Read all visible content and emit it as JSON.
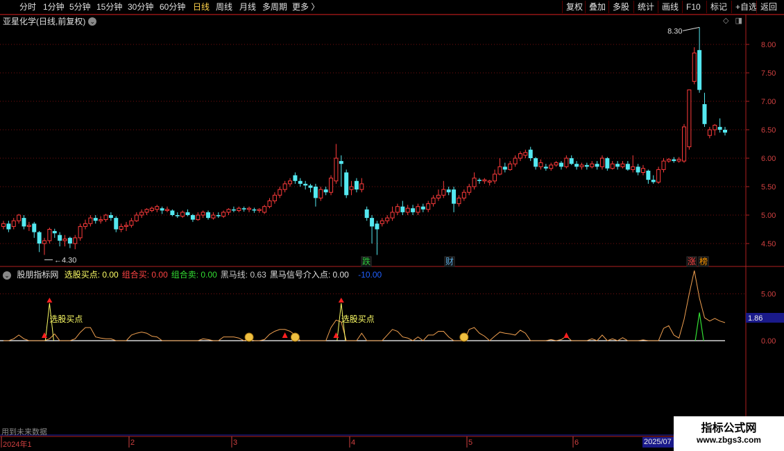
{
  "toolbar": {
    "periods": [
      "分时",
      "1分钟",
      "5分钟",
      "15分钟",
      "30分钟",
      "60分钟",
      "日线",
      "周线",
      "月线",
      "多周期",
      "更多"
    ],
    "selected_period": "日线",
    "more_arrow": "〉",
    "right_buttons": [
      "复权",
      "叠加",
      "多股",
      "统计",
      "画线",
      "F10",
      "标记",
      "+自选",
      "返回"
    ]
  },
  "main_chart": {
    "title": "亚星化学(日线,前复权)",
    "y_ticks": [
      "8.00",
      "7.50",
      "7.00",
      "6.50",
      "6.00",
      "5.50",
      "5.00",
      "4.50"
    ],
    "high_label": "8.30",
    "low_label": "4.30",
    "tags": [
      {
        "text": "跌",
        "color": "#2ecc40"
      },
      {
        "text": "财",
        "color": "#5dade2"
      },
      {
        "text": "涨",
        "color": "#ff4444"
      },
      {
        "text": "榜",
        "color": "#ff9900"
      }
    ],
    "colors": {
      "up": "#ff3b3b",
      "down": "#54e8f0",
      "grid": "#7a1010",
      "axis": "#b02020"
    }
  },
  "indicator": {
    "name": "股朋指标网",
    "fields": [
      {
        "label": "选股买点:",
        "value": "0.00",
        "color": "#ffff66"
      },
      {
        "label": "组合买:",
        "value": "0.00",
        "color": "#ff4444"
      },
      {
        "label": "组合卖:",
        "value": "0.00",
        "color": "#33dd33"
      },
      {
        "label": "黑马线:",
        "value": "0.63",
        "color": "#c8c8c8"
      },
      {
        "label": "黑马信号介入点:",
        "value": "0.00",
        "color": "#e0e0e0"
      }
    ],
    "extra_value": "-10.00",
    "y_ticks": [
      "5.00",
      "0.00"
    ],
    "cursor_value": "1.86",
    "signal_text": "选股买点"
  },
  "future_note": "用到未来数据",
  "date_axis": {
    "labels": [
      "2024年1",
      "2",
      "3",
      "4",
      "5",
      "6"
    ],
    "current": "2025/07"
  },
  "watermark": {
    "line1": "指标公式网",
    "line2": "www.zbgs3.com"
  },
  "chart_data": {
    "type": "candlestick",
    "title": "亚星化学(日线,前复权)",
    "ylim": [
      4.2,
      8.4
    ],
    "candles": [
      {
        "o": 4.8,
        "c": 4.85,
        "h": 4.9,
        "l": 4.75
      },
      {
        "o": 4.85,
        "c": 4.75,
        "h": 4.9,
        "l": 4.7
      },
      {
        "o": 4.8,
        "c": 4.9,
        "h": 4.95,
        "l": 4.75
      },
      {
        "o": 4.9,
        "c": 5.0,
        "h": 5.02,
        "l": 4.85
      },
      {
        "o": 4.95,
        "c": 4.8,
        "h": 5.0,
        "l": 4.75
      },
      {
        "o": 4.8,
        "c": 4.82,
        "h": 4.88,
        "l": 4.72
      },
      {
        "o": 4.85,
        "c": 4.7,
        "h": 4.88,
        "l": 4.6
      },
      {
        "o": 4.7,
        "c": 4.5,
        "h": 4.72,
        "l": 4.35
      },
      {
        "o": 4.5,
        "c": 4.55,
        "h": 4.6,
        "l": 4.3
      },
      {
        "o": 4.55,
        "c": 4.75,
        "h": 4.78,
        "l": 4.5
      },
      {
        "o": 4.72,
        "c": 4.68,
        "h": 4.76,
        "l": 4.6
      },
      {
        "o": 4.65,
        "c": 4.55,
        "h": 4.7,
        "l": 4.45
      },
      {
        "o": 4.55,
        "c": 4.58,
        "h": 4.65,
        "l": 4.45
      },
      {
        "o": 4.6,
        "c": 4.5,
        "h": 4.62,
        "l": 4.42
      },
      {
        "o": 4.5,
        "c": 4.6,
        "h": 4.65,
        "l": 4.4
      },
      {
        "o": 4.6,
        "c": 4.8,
        "h": 4.85,
        "l": 4.55
      },
      {
        "o": 4.8,
        "c": 4.85,
        "h": 4.92,
        "l": 4.75
      },
      {
        "o": 4.85,
        "c": 4.95,
        "h": 5.0,
        "l": 4.8
      },
      {
        "o": 4.95,
        "c": 4.9,
        "h": 5.0,
        "l": 4.85
      },
      {
        "o": 4.9,
        "c": 4.92,
        "h": 4.98,
        "l": 4.85
      },
      {
        "o": 4.92,
        "c": 5.0,
        "h": 5.02,
        "l": 4.88
      },
      {
        "o": 5.0,
        "c": 4.95,
        "h": 5.05,
        "l": 4.9
      },
      {
        "o": 4.95,
        "c": 4.75,
        "h": 4.98,
        "l": 4.7
      },
      {
        "o": 4.75,
        "c": 4.8,
        "h": 4.85,
        "l": 4.7
      },
      {
        "o": 4.8,
        "c": 4.82,
        "h": 4.88,
        "l": 4.72
      },
      {
        "o": 4.82,
        "c": 4.9,
        "h": 4.95,
        "l": 4.78
      },
      {
        "o": 4.9,
        "c": 5.0,
        "h": 5.05,
        "l": 4.88
      },
      {
        "o": 5.0,
        "c": 5.05,
        "h": 5.1,
        "l": 4.95
      },
      {
        "o": 5.05,
        "c": 5.1,
        "h": 5.12,
        "l": 5.0
      },
      {
        "o": 5.08,
        "c": 5.12,
        "h": 5.15,
        "l": 5.05
      },
      {
        "o": 5.1,
        "c": 5.15,
        "h": 5.18,
        "l": 5.05
      },
      {
        "o": 5.12,
        "c": 5.08,
        "h": 5.15,
        "l": 5.02
      },
      {
        "o": 5.08,
        "c": 5.1,
        "h": 5.15,
        "l": 5.05
      },
      {
        "o": 5.08,
        "c": 5.0,
        "h": 5.1,
        "l": 4.98
      },
      {
        "o": 5.0,
        "c": 4.98,
        "h": 5.05,
        "l": 4.95
      },
      {
        "o": 4.98,
        "c": 5.05,
        "h": 5.08,
        "l": 4.95
      },
      {
        "o": 5.05,
        "c": 5.0,
        "h": 5.1,
        "l": 4.98
      },
      {
        "o": 5.0,
        "c": 4.92,
        "h": 5.02,
        "l": 4.88
      },
      {
        "o": 4.92,
        "c": 5.0,
        "h": 5.05,
        "l": 4.9
      },
      {
        "o": 5.0,
        "c": 5.05,
        "h": 5.08,
        "l": 4.95
      },
      {
        "o": 5.05,
        "c": 4.95,
        "h": 5.08,
        "l": 4.92
      },
      {
        "o": 4.95,
        "c": 5.0,
        "h": 5.05,
        "l": 4.92
      },
      {
        "o": 5.0,
        "c": 4.98,
        "h": 5.05,
        "l": 4.95
      },
      {
        "o": 4.98,
        "c": 5.05,
        "h": 5.08,
        "l": 4.95
      },
      {
        "o": 5.05,
        "c": 5.1,
        "h": 5.12,
        "l": 5.0
      },
      {
        "o": 5.1,
        "c": 5.08,
        "h": 5.15,
        "l": 5.05
      },
      {
        "o": 5.08,
        "c": 5.12,
        "h": 5.15,
        "l": 5.05
      },
      {
        "o": 5.12,
        "c": 5.1,
        "h": 5.15,
        "l": 5.06
      },
      {
        "o": 5.1,
        "c": 5.12,
        "h": 5.15,
        "l": 5.05
      },
      {
        "o": 5.1,
        "c": 5.08,
        "h": 5.13,
        "l": 5.04
      },
      {
        "o": 5.08,
        "c": 5.1,
        "h": 5.12,
        "l": 5.04
      },
      {
        "o": 5.05,
        "c": 5.15,
        "h": 5.18,
        "l": 5.02
      },
      {
        "o": 5.15,
        "c": 5.25,
        "h": 5.3,
        "l": 5.12
      },
      {
        "o": 5.25,
        "c": 5.35,
        "h": 5.4,
        "l": 5.2
      },
      {
        "o": 5.35,
        "c": 5.45,
        "h": 5.5,
        "l": 5.3
      },
      {
        "o": 5.45,
        "c": 5.55,
        "h": 5.6,
        "l": 5.4
      },
      {
        "o": 5.55,
        "c": 5.6,
        "h": 5.65,
        "l": 5.5
      },
      {
        "o": 5.7,
        "c": 5.6,
        "h": 5.75,
        "l": 5.55
      },
      {
        "o": 5.6,
        "c": 5.55,
        "h": 5.65,
        "l": 5.5
      },
      {
        "o": 5.55,
        "c": 5.52,
        "h": 5.6,
        "l": 5.45
      },
      {
        "o": 5.52,
        "c": 5.48,
        "h": 5.55,
        "l": 5.4
      },
      {
        "o": 5.5,
        "c": 5.3,
        "h": 5.55,
        "l": 5.15
      },
      {
        "o": 5.3,
        "c": 5.45,
        "h": 5.5,
        "l": 5.25
      },
      {
        "o": 5.45,
        "c": 5.4,
        "h": 5.5,
        "l": 5.35
      },
      {
        "o": 5.4,
        "c": 5.65,
        "h": 5.7,
        "l": 5.35
      },
      {
        "o": 5.6,
        "c": 6.0,
        "h": 6.25,
        "l": 5.55
      },
      {
        "o": 5.95,
        "c": 5.9,
        "h": 6.05,
        "l": 5.5
      },
      {
        "o": 5.75,
        "c": 5.35,
        "h": 5.8,
        "l": 5.3
      },
      {
        "o": 5.45,
        "c": 5.5,
        "h": 5.6,
        "l": 5.35
      },
      {
        "o": 5.6,
        "c": 5.45,
        "h": 5.65,
        "l": 5.4
      },
      {
        "o": 5.45,
        "c": 5.55,
        "h": 5.65,
        "l": 5.4
      },
      {
        "o": 5.1,
        "c": 4.95,
        "h": 5.15,
        "l": 4.9
      },
      {
        "o": 4.95,
        "c": 4.8,
        "h": 5.0,
        "l": 4.5
      },
      {
        "o": 4.85,
        "c": 4.75,
        "h": 4.9,
        "l": 4.3
      },
      {
        "o": 4.85,
        "c": 4.9,
        "h": 4.95,
        "l": 4.8
      },
      {
        "o": 4.9,
        "c": 4.95,
        "h": 5.0,
        "l": 4.85
      },
      {
        "o": 4.95,
        "c": 5.05,
        "h": 5.15,
        "l": 4.9
      },
      {
        "o": 5.05,
        "c": 5.15,
        "h": 5.2,
        "l": 5.0
      },
      {
        "o": 5.15,
        "c": 5.05,
        "h": 5.25,
        "l": 5.0
      },
      {
        "o": 5.05,
        "c": 5.12,
        "h": 5.18,
        "l": 5.0
      },
      {
        "o": 5.12,
        "c": 5.05,
        "h": 5.18,
        "l": 5.0
      },
      {
        "o": 5.05,
        "c": 5.15,
        "h": 5.2,
        "l": 5.0
      },
      {
        "o": 5.15,
        "c": 5.1,
        "h": 5.2,
        "l": 5.05
      },
      {
        "o": 5.1,
        "c": 5.2,
        "h": 5.25,
        "l": 5.05
      },
      {
        "o": 5.2,
        "c": 5.3,
        "h": 5.35,
        "l": 5.15
      },
      {
        "o": 5.3,
        "c": 5.35,
        "h": 5.45,
        "l": 5.25
      },
      {
        "o": 5.35,
        "c": 5.45,
        "h": 5.6,
        "l": 5.3
      },
      {
        "o": 5.45,
        "c": 5.4,
        "h": 5.5,
        "l": 5.35
      },
      {
        "o": 5.45,
        "c": 5.2,
        "h": 5.5,
        "l": 5.05
      },
      {
        "o": 5.2,
        "c": 5.3,
        "h": 5.35,
        "l": 5.15
      },
      {
        "o": 5.3,
        "c": 5.4,
        "h": 5.45,
        "l": 5.25
      },
      {
        "o": 5.4,
        "c": 5.5,
        "h": 5.55,
        "l": 5.35
      },
      {
        "o": 5.5,
        "c": 5.65,
        "h": 5.75,
        "l": 5.45
      },
      {
        "o": 5.62,
        "c": 5.6,
        "h": 5.65,
        "l": 5.55
      },
      {
        "o": 5.6,
        "c": 5.62,
        "h": 5.65,
        "l": 5.55
      },
      {
        "o": 5.58,
        "c": 5.6,
        "h": 5.62,
        "l": 5.52
      },
      {
        "o": 5.6,
        "c": 5.72,
        "h": 5.8,
        "l": 5.55
      },
      {
        "o": 5.72,
        "c": 5.85,
        "h": 6.0,
        "l": 5.7
      },
      {
        "o": 5.85,
        "c": 5.8,
        "h": 5.92,
        "l": 5.75
      },
      {
        "o": 5.8,
        "c": 5.9,
        "h": 5.95,
        "l": 5.78
      },
      {
        "o": 5.9,
        "c": 6.0,
        "h": 6.05,
        "l": 5.85
      },
      {
        "o": 6.0,
        "c": 6.08,
        "h": 6.12,
        "l": 5.95
      },
      {
        "o": 6.05,
        "c": 6.1,
        "h": 6.15,
        "l": 6.0
      },
      {
        "o": 6.15,
        "c": 6.0,
        "h": 6.2,
        "l": 5.95
      },
      {
        "o": 6.0,
        "c": 5.85,
        "h": 6.02,
        "l": 5.8
      },
      {
        "o": 5.85,
        "c": 5.92,
        "h": 5.98,
        "l": 5.8
      },
      {
        "o": 5.85,
        "c": 5.82,
        "h": 5.9,
        "l": 5.78
      },
      {
        "o": 5.82,
        "c": 5.88,
        "h": 5.92,
        "l": 5.78
      },
      {
        "o": 5.88,
        "c": 5.92,
        "h": 5.95,
        "l": 5.85
      },
      {
        "o": 5.92,
        "c": 5.85,
        "h": 5.95,
        "l": 5.8
      },
      {
        "o": 5.85,
        "c": 6.0,
        "h": 6.05,
        "l": 5.82
      },
      {
        "o": 6.0,
        "c": 5.9,
        "h": 6.05,
        "l": 5.88
      },
      {
        "o": 5.9,
        "c": 5.85,
        "h": 5.95,
        "l": 5.8
      },
      {
        "o": 5.85,
        "c": 5.88,
        "h": 5.92,
        "l": 5.8
      },
      {
        "o": 5.88,
        "c": 5.85,
        "h": 5.92,
        "l": 5.8
      },
      {
        "o": 5.85,
        "c": 5.9,
        "h": 5.95,
        "l": 5.82
      },
      {
        "o": 5.9,
        "c": 5.85,
        "h": 5.95,
        "l": 5.8
      },
      {
        "o": 5.85,
        "c": 6.0,
        "h": 6.05,
        "l": 5.8
      },
      {
        "o": 6.0,
        "c": 5.82,
        "h": 6.02,
        "l": 5.78
      },
      {
        "o": 5.82,
        "c": 5.9,
        "h": 5.95,
        "l": 5.8
      },
      {
        "o": 5.9,
        "c": 5.85,
        "h": 5.95,
        "l": 5.8
      },
      {
        "o": 5.85,
        "c": 5.9,
        "h": 5.95,
        "l": 5.82
      },
      {
        "o": 5.9,
        "c": 5.8,
        "h": 5.95,
        "l": 5.78
      },
      {
        "o": 5.8,
        "c": 5.85,
        "h": 6.05,
        "l": 5.75
      },
      {
        "o": 5.85,
        "c": 5.75,
        "h": 5.9,
        "l": 5.7
      },
      {
        "o": 5.75,
        "c": 5.82,
        "h": 5.88,
        "l": 5.7
      },
      {
        "o": 5.78,
        "c": 5.62,
        "h": 5.8,
        "l": 5.55
      },
      {
        "o": 5.62,
        "c": 5.58,
        "h": 5.7,
        "l": 5.55
      },
      {
        "o": 5.58,
        "c": 5.8,
        "h": 5.85,
        "l": 5.55
      },
      {
        "o": 5.8,
        "c": 5.95,
        "h": 6.0,
        "l": 5.75
      },
      {
        "o": 5.95,
        "c": 5.98,
        "h": 6.0,
        "l": 5.92
      },
      {
        "o": 5.98,
        "c": 5.95,
        "h": 6.02,
        "l": 5.92
      },
      {
        "o": 5.95,
        "c": 5.98,
        "h": 6.02,
        "l": 5.92
      },
      {
        "o": 5.95,
        "c": 6.55,
        "h": 6.6,
        "l": 5.92
      },
      {
        "o": 6.2,
        "c": 7.2,
        "h": 7.2,
        "l": 6.15
      },
      {
        "o": 7.35,
        "c": 7.85,
        "h": 7.95,
        "l": 7.3
      },
      {
        "o": 7.9,
        "c": 7.2,
        "h": 8.3,
        "l": 7.15
      },
      {
        "o": 6.95,
        "c": 6.6,
        "h": 7.15,
        "l": 6.55
      },
      {
        "o": 6.4,
        "c": 6.5,
        "h": 6.55,
        "l": 6.35
      },
      {
        "o": 6.5,
        "c": 6.58,
        "h": 6.6,
        "l": 6.4
      },
      {
        "o": 6.55,
        "c": 6.5,
        "h": 6.7,
        "l": 6.45
      },
      {
        "o": 6.5,
        "c": 6.45,
        "h": 6.55,
        "l": 6.4
      }
    ],
    "indicator_series": {
      "markers_buy": [
        9,
        66
      ],
      "markers_up": [
        8,
        55,
        65,
        110
      ],
      "markers_money": [
        48,
        57,
        90
      ]
    }
  }
}
